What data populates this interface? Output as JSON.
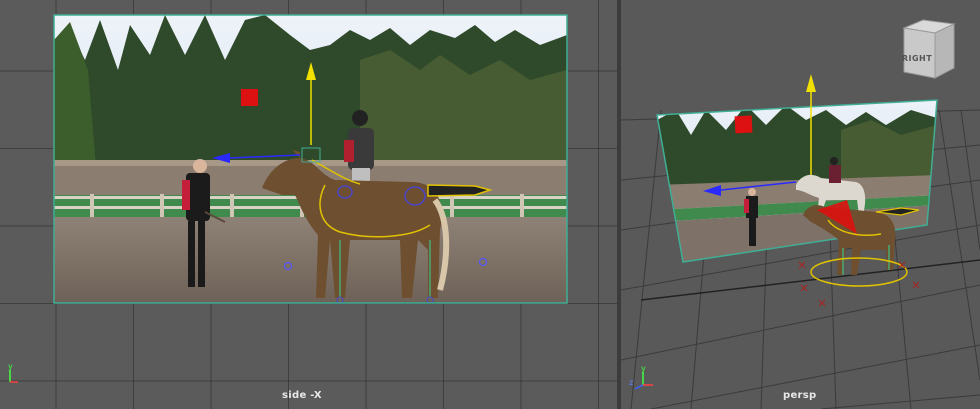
{
  "viewports": {
    "side": {
      "label": "side -X"
    },
    "persp": {
      "label": "persp"
    }
  },
  "view_cube": {
    "face_label": "RIGHT"
  },
  "axis_labels": {
    "x": "x",
    "y": "y",
    "z": "z"
  },
  "colors": {
    "viewport_bg": "#5b5b5b",
    "grid_line": "#3a3a3a",
    "divider": "#3c3c3c",
    "image_plane_border": "#3fae94",
    "manipulator_yellow": "#f2e000",
    "manipulator_blue": "#2a2aff",
    "locator_red": "#dd1111",
    "rig_curve": "#e0c200",
    "horse_body": "#6e4f30",
    "axis_x": "#ff4040",
    "axis_y": "#40ff40",
    "axis_z": "#4060ff"
  }
}
